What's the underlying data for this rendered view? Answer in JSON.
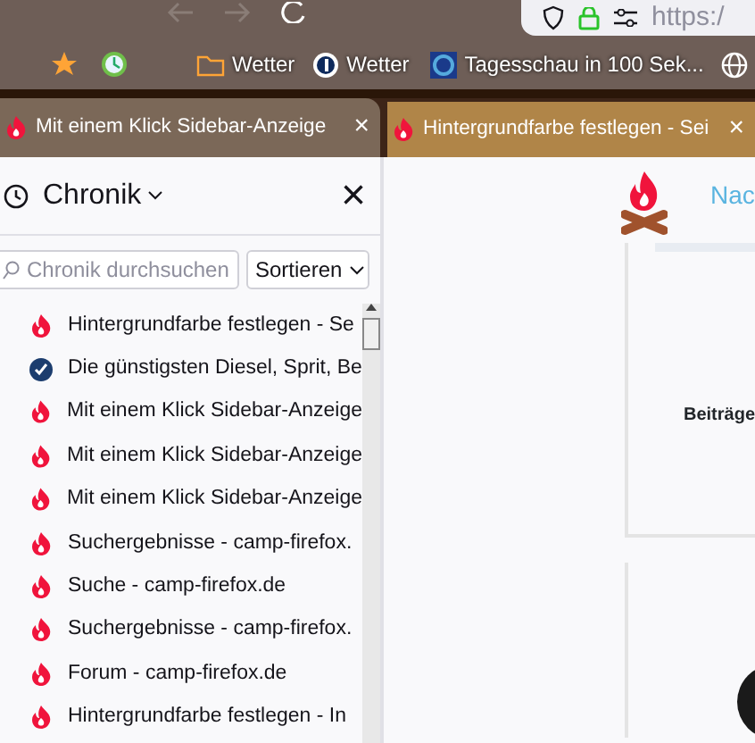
{
  "toolbar": {
    "url": "https:/"
  },
  "bookmarks": [
    {
      "kind": "star"
    },
    {
      "kind": "clock"
    },
    {
      "kind": "folder",
      "label": "Wetter"
    },
    {
      "kind": "ard",
      "label": "Wetter"
    },
    {
      "kind": "tagesschau",
      "label": "Tagesschau in 100 Sek..."
    },
    {
      "kind": "globe"
    }
  ],
  "tabs": [
    {
      "label": "Mit einem Klick Sidebar-Anzeige",
      "selected": false,
      "close": "×"
    },
    {
      "label": "Hintergrundfarbe festlegen - Sei",
      "selected": true,
      "close": "×"
    }
  ],
  "sidebar": {
    "title": "Chronik",
    "close": "×",
    "search": {
      "placeholder": "Chronik durchsuchen"
    },
    "sort_button": "Sortieren",
    "items": [
      {
        "kind": "flame",
        "label": "Hintergrundfarbe festlegen - Se"
      },
      {
        "kind": "badge",
        "label": "Die günstigsten Diesel, Sprit, Be"
      },
      {
        "kind": "flame",
        "label": "Mit einem Klick Sidebar-Anzeige"
      },
      {
        "kind": "flame",
        "label": "Mit einem Klick Sidebar-Anzeige"
      },
      {
        "kind": "flame",
        "label": "Mit einem Klick Sidebar-Anzeige"
      },
      {
        "kind": "flame",
        "label": "Suchergebnisse - camp-firefox."
      },
      {
        "kind": "flame",
        "label": "Suche - camp-firefox.de"
      },
      {
        "kind": "flame",
        "label": "Suchergebnisse - camp-firefox."
      },
      {
        "kind": "flame",
        "label": "Forum - camp-firefox.de"
      },
      {
        "kind": "flame",
        "label": "Hintergrundfarbe festlegen - In"
      }
    ]
  },
  "content": {
    "nav_link": "Nac",
    "card_text": "Beiträge"
  }
}
